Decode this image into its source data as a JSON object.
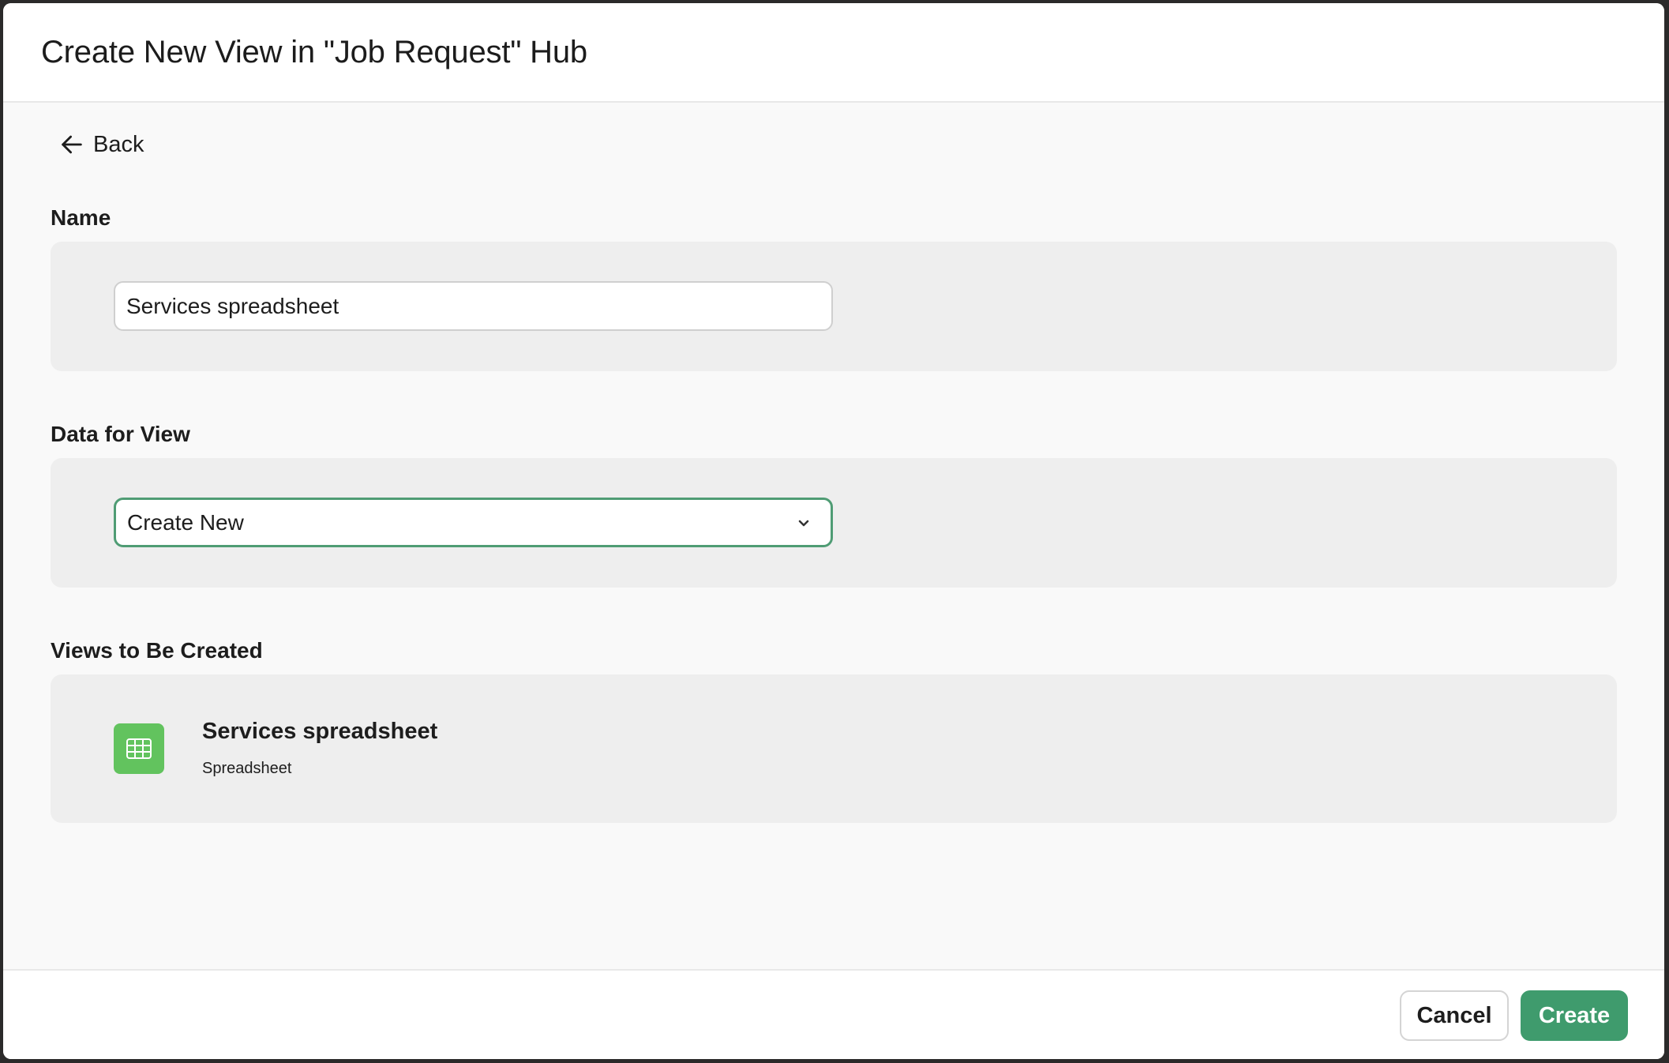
{
  "dialog": {
    "title": "Create New View in \"Job Request\" Hub"
  },
  "back": {
    "label": "Back",
    "icon": "arrow-left-icon"
  },
  "name_section": {
    "label": "Name",
    "input_value": "Services spreadsheet"
  },
  "data_section": {
    "label": "Data for View",
    "selected": "Create New",
    "icon": "chevron-down-icon"
  },
  "views_section": {
    "label": "Views to Be Created",
    "items": [
      {
        "name": "Services spreadsheet",
        "type": "Spreadsheet",
        "icon": "spreadsheet-icon",
        "icon_color": "#62c35e"
      }
    ]
  },
  "footer": {
    "cancel_label": "Cancel",
    "create_label": "Create"
  },
  "colors": {
    "accent": "#3f9b6d",
    "focus_border": "#4f9c74"
  }
}
